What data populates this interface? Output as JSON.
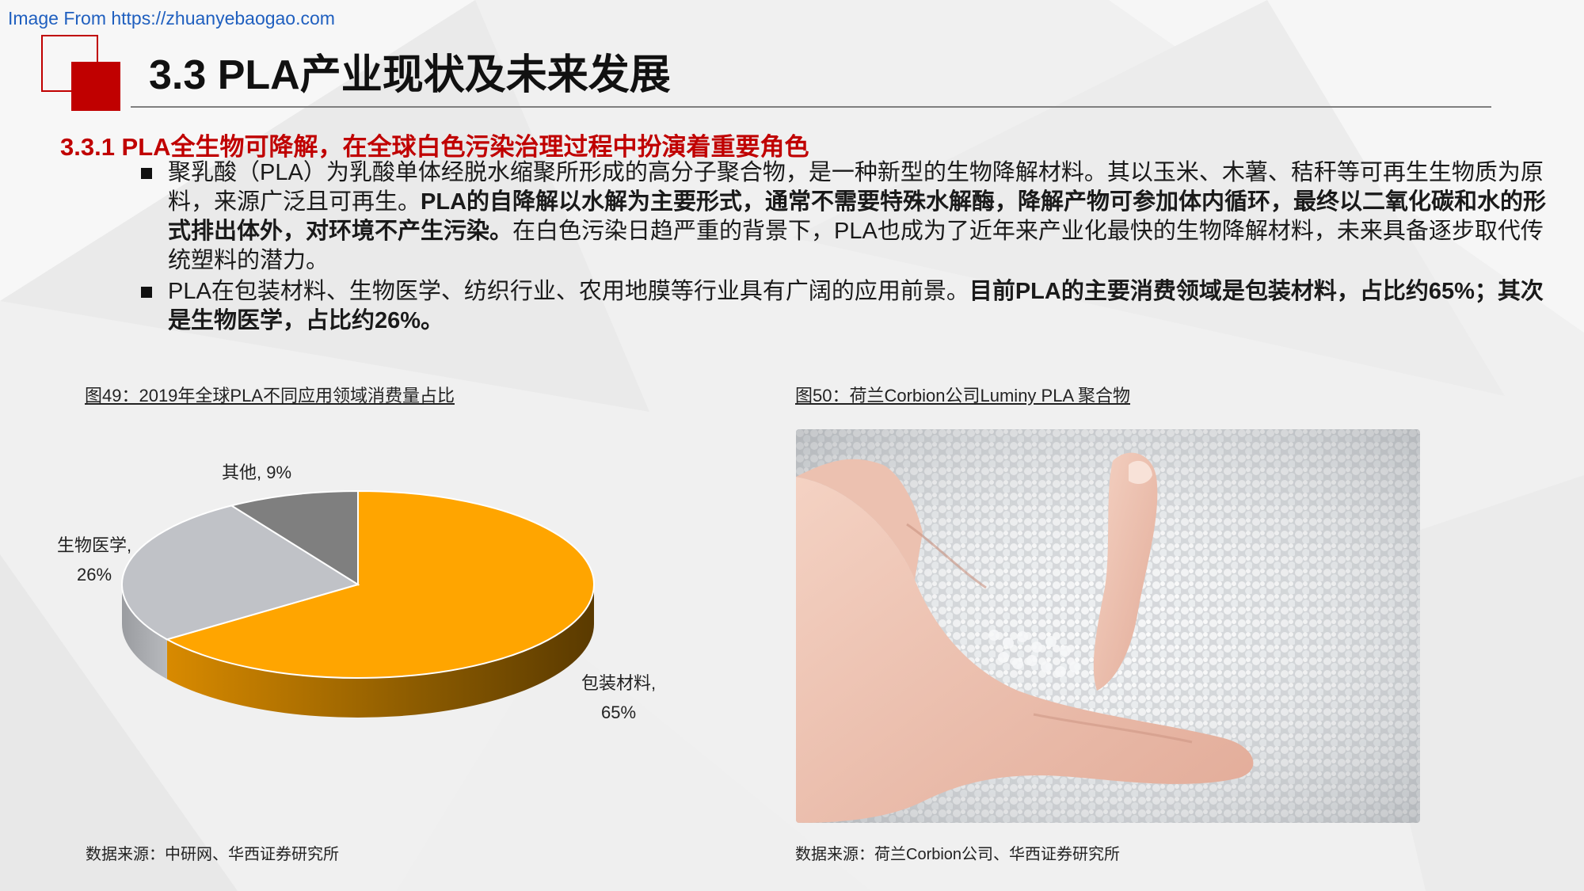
{
  "watermark": "Image From https://zhuanyebaogao.com",
  "title": "3.3 PLA产业现状及未来发展",
  "subheading": "3.3.1 PLA全生物可降解，在全球白色污染治理过程中扮演着重要角色",
  "bullets": [
    {
      "p1": "聚乳酸（PLA）为乳酸单体经脱水缩聚所形成的高分子聚合物，是一种新型的生物降解材料。其以玉米、木薯、秸秆等可再生生物质为原料，来源广泛且可再生。",
      "b1": "PLA的自降解以水解为主要形式，通常不需要特殊水解酶，降解产物可参加体内循环，最终以二氧化碳和水的形式排出体外，对环境不产生污染。",
      "p2": "在白色污染日趋严重的背景下，PLA也成为了近年来产业化最快的生物降解材料，未来具备逐步取代传统塑料的潜力。"
    },
    {
      "p1": "PLA在包装材料、生物医学、纺织行业、农用地膜等行业具有广阔的应用前景。",
      "b1": "目前PLA的主要消费领域是包装材料，占比约65%；其次是生物医学，占比约26%。"
    }
  ],
  "figure49": {
    "caption": "图49：2019年全球PLA不同应用领域消费量占比",
    "source": "数据来源：中研网、华西证券研究所"
  },
  "figure50": {
    "caption": "图50：荷兰Corbion公司Luminy PLA 聚合物",
    "source": "数据来源：荷兰Corbion公司、华西证券研究所"
  },
  "chart_data": {
    "type": "pie",
    "title": "",
    "slices": [
      {
        "label": "包装材料",
        "pct_text": "65%",
        "value": 65,
        "color": "#ffa500"
      },
      {
        "label": "生物医学",
        "pct_text": "26%",
        "value": 26,
        "color": "#c0c2c7"
      },
      {
        "label": "其他",
        "pct_text": "9%",
        "value": 9,
        "color": "#7f7f7f"
      }
    ],
    "style": "3d"
  },
  "colors": {
    "accent": "#c00000",
    "pie_packaging": "#ffa500",
    "pie_biomed": "#c0c2c7",
    "pie_other": "#7f7f7f"
  }
}
